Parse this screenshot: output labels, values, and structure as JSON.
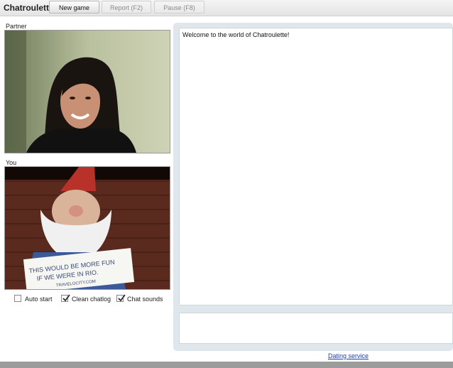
{
  "app": {
    "title": "Chatroulette"
  },
  "toolbar": {
    "new_game_label": "New game",
    "report_label": "Report (F2)",
    "pause_label": "Pause (F8)"
  },
  "partner": {
    "label": "Partner"
  },
  "you": {
    "label": "You",
    "sign_lines": [
      "THIS WOULD BE MORE FUN",
      "IF WE WERE IN RIO.",
      "TRAVELOCITY.COM"
    ]
  },
  "options": [
    {
      "label": "Auto start",
      "checked": false
    },
    {
      "label": "Clean chatlog",
      "checked": true
    },
    {
      "label": "Chat sounds",
      "checked": true
    }
  ],
  "chat": {
    "welcome_message": "Welcome to the world of Chatroulette!"
  },
  "footer": {
    "dating_link": "Dating service"
  },
  "colors": {
    "link": "#1f3fa8",
    "panel": "#dfe6ec",
    "bottom_bar": "#9c9c9c"
  }
}
